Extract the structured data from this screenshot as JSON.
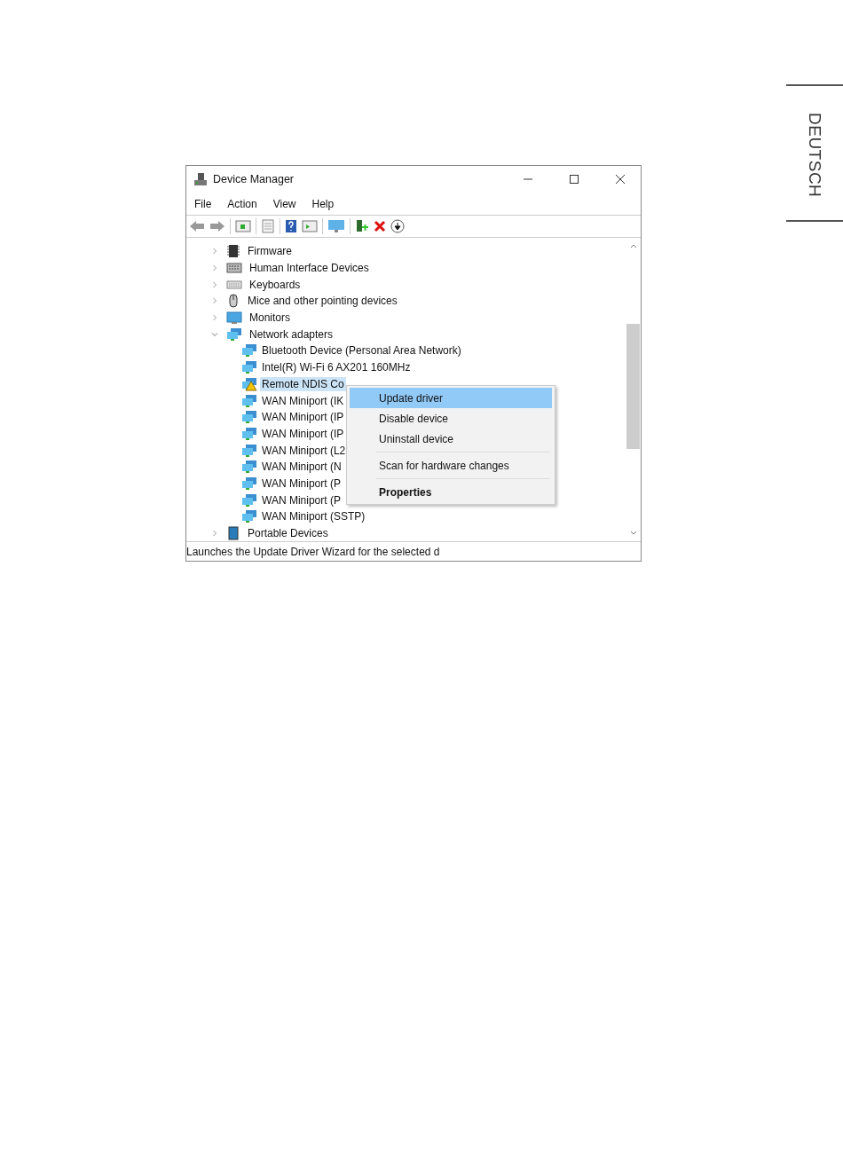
{
  "side_tab": {
    "label": "DEUTSCH"
  },
  "window": {
    "title": "Device Manager"
  },
  "menu": [
    "File",
    "Action",
    "View",
    "Help"
  ],
  "tree": [
    {
      "label": "Firmware",
      "expanded": false
    },
    {
      "label": "Human Interface Devices",
      "expanded": false
    },
    {
      "label": "Keyboards",
      "expanded": false
    },
    {
      "label": "Mice and other pointing devices",
      "expanded": false
    },
    {
      "label": "Monitors",
      "expanded": false
    },
    {
      "label": "Network adapters",
      "expanded": true,
      "children": [
        {
          "label": "Bluetooth Device (Personal Area Network)",
          "selected": false,
          "warning": false
        },
        {
          "label": "Intel(R) Wi-Fi 6 AX201 160MHz",
          "selected": false,
          "warning": false
        },
        {
          "label": "Remote NDIS Co",
          "selected": true,
          "warning": true
        },
        {
          "label": "WAN Miniport (IK",
          "selected": false,
          "warning": false
        },
        {
          "label": "WAN Miniport (IP",
          "selected": false,
          "warning": false
        },
        {
          "label": "WAN Miniport (IP",
          "selected": false,
          "warning": false
        },
        {
          "label": "WAN Miniport (L2",
          "selected": false,
          "warning": false
        },
        {
          "label": "WAN Miniport (N",
          "selected": false,
          "warning": false
        },
        {
          "label": "WAN Miniport (P",
          "selected": false,
          "warning": false
        },
        {
          "label": "WAN Miniport (P",
          "selected": false,
          "warning": false
        },
        {
          "label": "WAN Miniport (SSTP)",
          "selected": false,
          "warning": false
        }
      ]
    },
    {
      "label": "Portable Devices",
      "expanded": false
    }
  ],
  "context_menu": [
    {
      "label": "Update driver",
      "selected": true,
      "kind": "normal"
    },
    {
      "label": "Disable device",
      "selected": false,
      "kind": "normal"
    },
    {
      "label": "Uninstall device",
      "selected": false,
      "kind": "normal"
    },
    {
      "label": "Scan for hardware changes",
      "selected": false,
      "kind": "group"
    },
    {
      "label": "Properties",
      "selected": false,
      "kind": "default"
    }
  ],
  "status_bar": "Launches the Update Driver Wizard for the selected d"
}
